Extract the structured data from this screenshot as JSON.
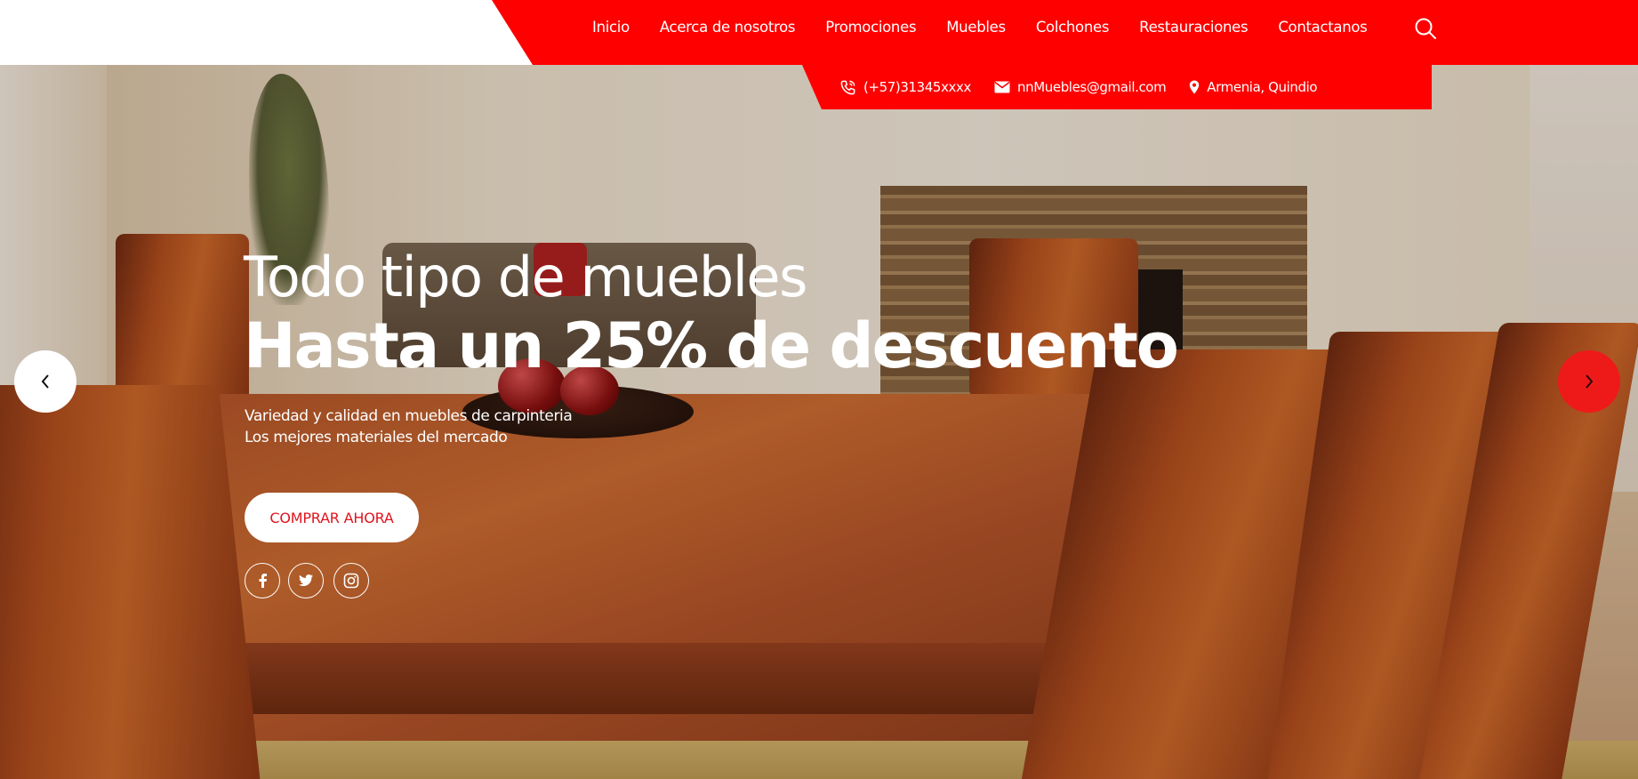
{
  "nav": {
    "items": [
      {
        "label": "Inicio"
      },
      {
        "label": "Acerca de nosotros"
      },
      {
        "label": "Promociones"
      },
      {
        "label": "Muebles"
      },
      {
        "label": "Colchones"
      },
      {
        "label": "Restauraciones"
      },
      {
        "label": "Contactanos"
      }
    ],
    "search_icon": "search-icon"
  },
  "contact": {
    "phone": "(+57)31345xxxx",
    "email": "nnMuebles@gmail.com",
    "location": "Armenia, Quindio"
  },
  "hero": {
    "title_line1": "Todo tipo de muebles",
    "title_line2": "Hasta un 25% de descuento",
    "subtitle_line1": "Variedad y calidad en muebles de carpinteria",
    "subtitle_line2": "Los mejores materiales del mercado",
    "cta_label": "COMPRAR AHORA",
    "social": [
      "facebook-icon",
      "twitter-icon",
      "instagram-icon"
    ]
  },
  "carousel": {
    "prev_icon": "chevron-left-icon",
    "next_icon": "chevron-right-icon"
  },
  "colors": {
    "brand_red": "#ff0000",
    "cta_text": "#e0141e",
    "white": "#ffffff"
  }
}
